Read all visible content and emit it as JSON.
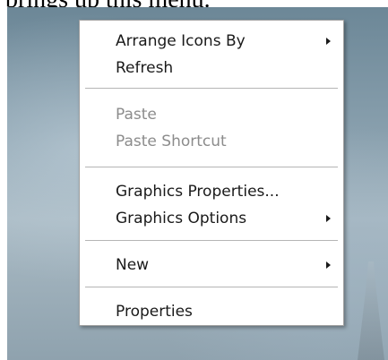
{
  "caption": "brings up this menu.",
  "menu": {
    "items": [
      {
        "label": "Arrange Icons By",
        "submenu": true,
        "enabled": true
      },
      {
        "label": "Refresh",
        "submenu": false,
        "enabled": true
      },
      {
        "label": "Paste",
        "submenu": false,
        "enabled": false
      },
      {
        "label": "Paste Shortcut",
        "submenu": false,
        "enabled": false
      },
      {
        "label": "Graphics Properties...",
        "submenu": false,
        "enabled": true
      },
      {
        "label": "Graphics Options",
        "submenu": true,
        "enabled": true
      },
      {
        "label": "New",
        "submenu": true,
        "enabled": true
      },
      {
        "label": "Properties",
        "submenu": false,
        "enabled": true
      }
    ]
  },
  "colors": {
    "menu_background": "#ffffff",
    "disabled_text": "#8c8c8c",
    "separator": "#b5b5b5"
  }
}
